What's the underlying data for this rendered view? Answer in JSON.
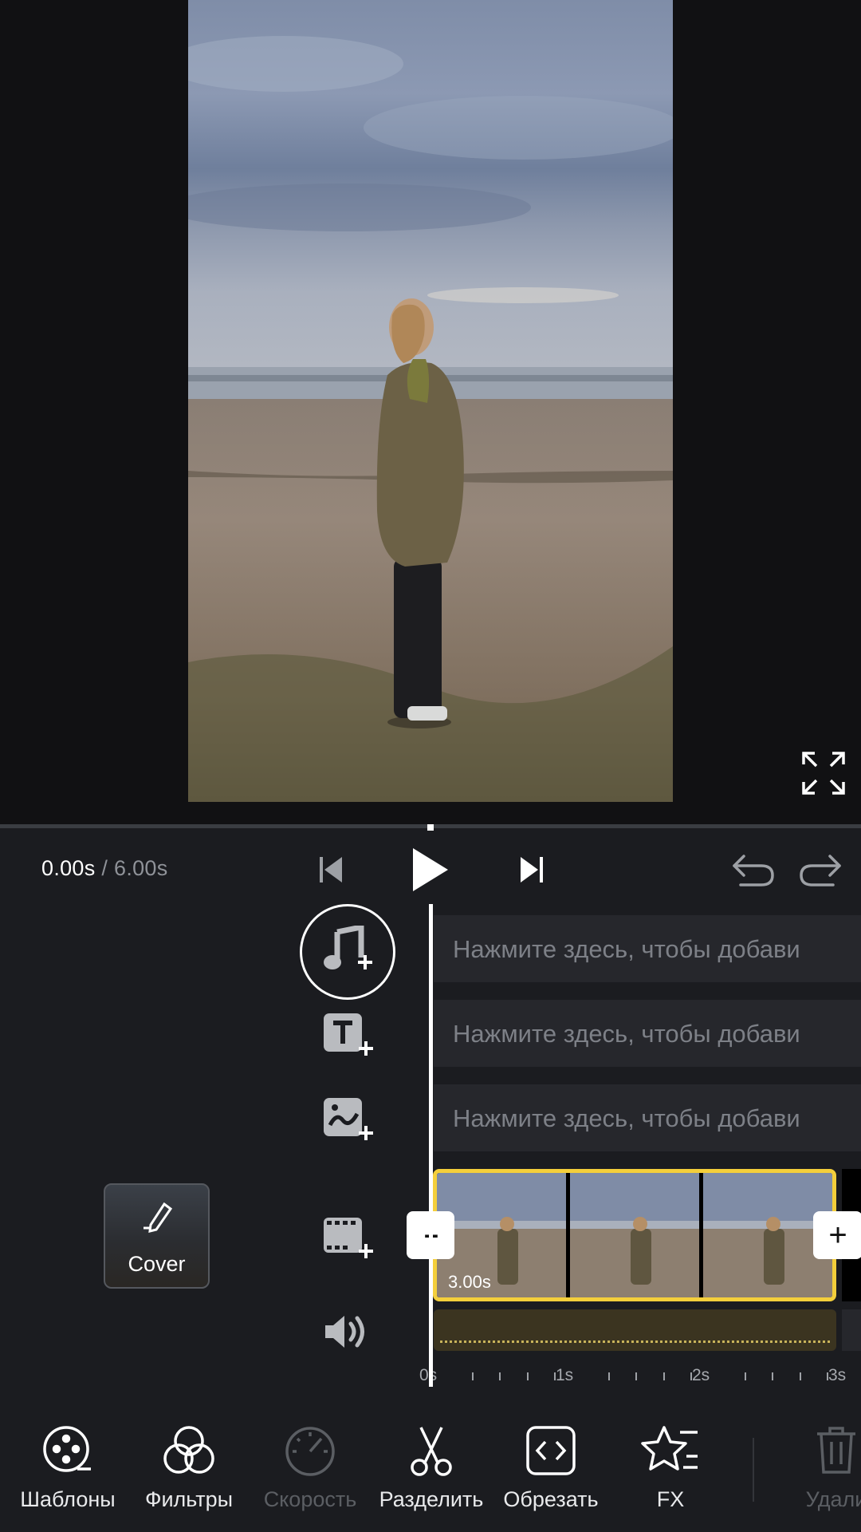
{
  "player": {
    "current_time": "0.00s",
    "separator": "/",
    "total_time": "6.00s"
  },
  "tracks": {
    "audio_placeholder": "Нажмите здесь, чтобы добави",
    "text_placeholder": "Нажмите здесь, чтобы добави",
    "sticker_placeholder": "Нажмите здесь, чтобы добави"
  },
  "cover": {
    "label": "Cover"
  },
  "clip": {
    "duration": "3.00s",
    "trim_left_label": "--",
    "add_right_label": "+"
  },
  "ruler": {
    "labels": [
      "0s",
      "1s",
      "2s",
      "3s"
    ]
  },
  "toolbar": {
    "items": [
      {
        "label": "Шаблоны",
        "icon": "templates-icon",
        "enabled": true
      },
      {
        "label": "Фильтры",
        "icon": "filters-icon",
        "enabled": true
      },
      {
        "label": "Скорость",
        "icon": "speed-icon",
        "enabled": false
      },
      {
        "label": "Разделить",
        "icon": "split-icon",
        "enabled": true
      },
      {
        "label": "Обрезать",
        "icon": "trim-icon",
        "enabled": true
      },
      {
        "label": "FX",
        "icon": "fx-icon",
        "enabled": true
      },
      {
        "label": "Удали",
        "icon": "delete-icon",
        "enabled": false
      }
    ]
  },
  "colors": {
    "accent_yellow": "#f4cf3b",
    "panel_bg": "#1b1c20",
    "track_bg": "#26272c"
  }
}
